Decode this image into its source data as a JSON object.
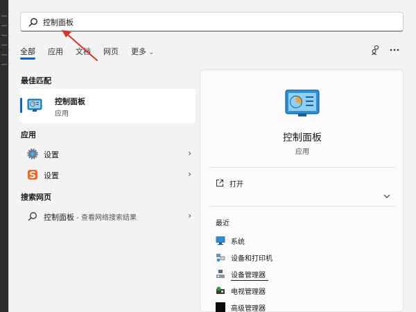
{
  "search": {
    "query": "控制面板"
  },
  "tabs": [
    {
      "label": "全部"
    },
    {
      "label": "应用"
    },
    {
      "label": "文档"
    },
    {
      "label": "网页"
    },
    {
      "label": "更多"
    }
  ],
  "tab_more_chevron": "⌄",
  "sections": {
    "best_match": "最佳匹配",
    "apps": "应用",
    "web": "搜索网页"
  },
  "best_match": {
    "title": "控制面板",
    "subtitle": "应用",
    "icon": "control-panel-icon"
  },
  "apps": [
    {
      "label": "设置",
      "icon": "gear-icon"
    },
    {
      "label": "设置",
      "icon": "sogou-icon"
    }
  ],
  "web_result": {
    "query": "控制面板",
    "suffix": " - 查看网络搜索结果",
    "icon": "search-icon"
  },
  "chevron": "›",
  "detail": {
    "title": "控制面板",
    "kind": "应用",
    "open_label": "打开",
    "recent_title": "最近",
    "recent": [
      {
        "label": "系统",
        "icon": "system-icon"
      },
      {
        "label": "设备和打印机",
        "icon": "devices-printers-icon"
      },
      {
        "label": "设备管理器",
        "icon": "device-manager-icon"
      },
      {
        "label": "电视管理器",
        "icon": "tv-manager-icon"
      },
      {
        "label": "高级管理器",
        "icon": "advanced-manager-icon"
      }
    ]
  },
  "colors": {
    "accent": "#0a64c8",
    "arrow": "#d9322b"
  }
}
